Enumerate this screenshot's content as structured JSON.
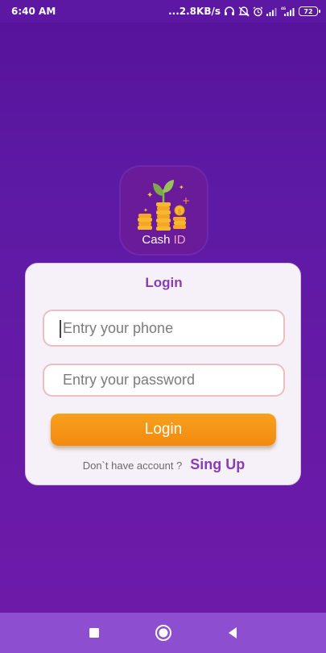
{
  "status_bar": {
    "time": "6:40 AM",
    "network_speed": "...2.8KB/s",
    "battery_level": "72",
    "icons": [
      "headset-icon",
      "mute-icon",
      "alarm-icon",
      "signal-icon",
      "signal-4g-icon",
      "battery-icon"
    ]
  },
  "app": {
    "logo_text_main": "Cash",
    "logo_text_accent": "ID"
  },
  "login_form": {
    "title": "Login",
    "phone_placeholder": "Entry your phone",
    "password_placeholder": "Entry your password",
    "login_button_label": "Login",
    "signup_question": "Don`t have account ?",
    "signup_link_label": "Sing Up"
  },
  "nav_bar": {
    "icons": [
      "recents-icon",
      "home-icon",
      "back-icon"
    ]
  },
  "colors": {
    "background": "#5d1aa4",
    "card": "#f6f1f8",
    "accent_purple": "#8a3bb8",
    "button_orange": "#f5961a",
    "field_border": "#e8bfc2",
    "nav_bar": "#8d4fcf"
  }
}
